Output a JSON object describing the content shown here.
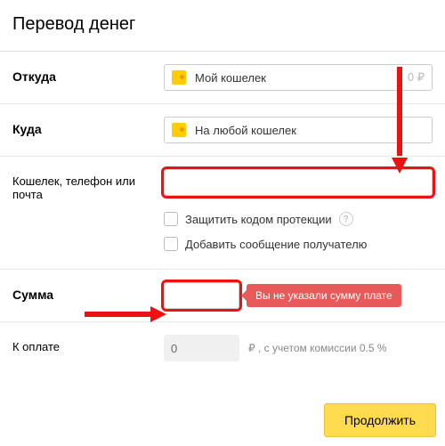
{
  "title": "Перевод денег",
  "from": {
    "label": "Откуда",
    "wallet": "Мой кошелек",
    "balance": "0 ₽"
  },
  "to": {
    "label": "Куда",
    "wallet": "На любой кошелек"
  },
  "recipient": {
    "label": "Кошелек, телефон или почта",
    "value": ""
  },
  "options": {
    "protect": "Защитить кодом протекции",
    "message": "Добавить сообщение получателю"
  },
  "sum": {
    "label": "Сумма",
    "value": "",
    "error": "Вы не указали сумму плате"
  },
  "topay": {
    "label": "К оплате",
    "value": "0",
    "hint": "₽ , с учетом комиссии 0.5 %"
  },
  "continue": "Продолжить"
}
